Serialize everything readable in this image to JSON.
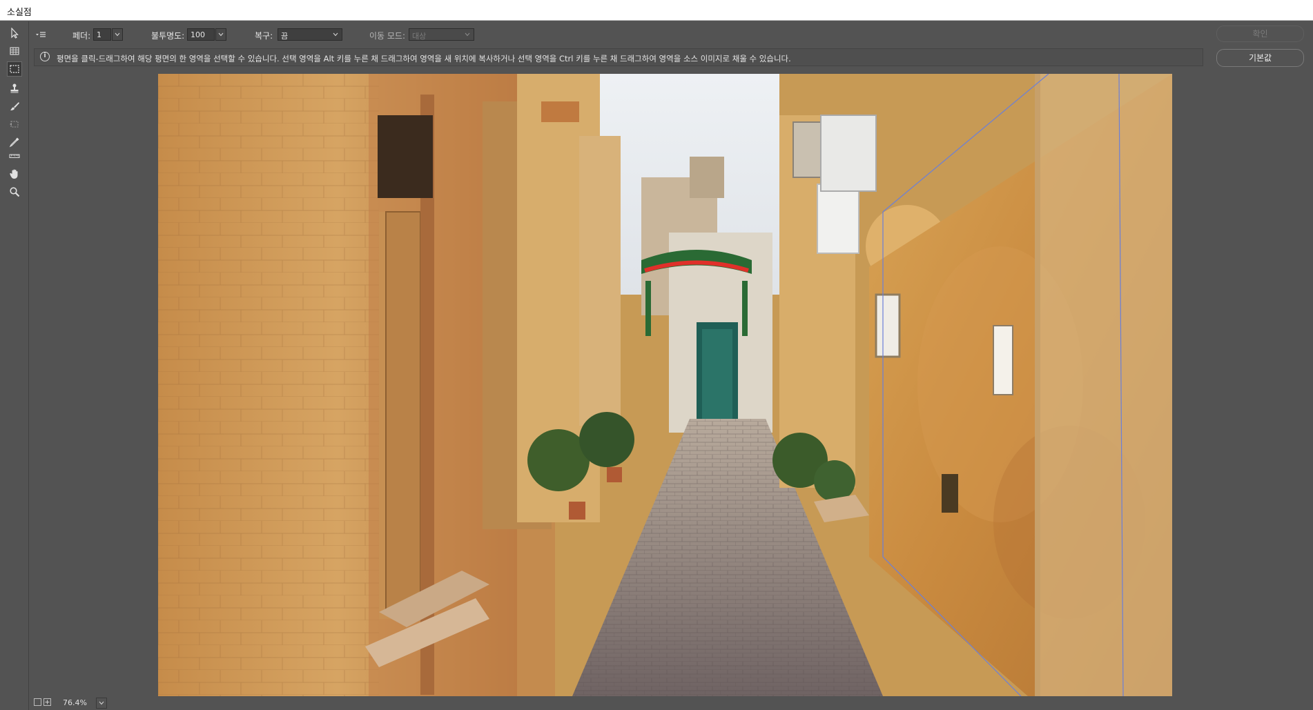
{
  "window": {
    "title": "소실점"
  },
  "options_bar": {
    "menu_icon": "flyout-menu-icon",
    "feather_label": "페더:",
    "feather_value": "1",
    "opacity_label": "불투명도:",
    "opacity_value": "100",
    "heal_label": "복구:",
    "heal_value": "끔",
    "move_mode_label": "이동 모드:",
    "move_mode_value": "대상",
    "ok_label": "확인",
    "default_label": "기본값"
  },
  "info": {
    "icon": "info-icon",
    "text": "평면을 클릭-드래그하여 해당 평면의 한 영역을 선택할 수 있습니다. 선택 영역을 Alt 키를 누른 채 드래그하여 영역을 새 위치에 복사하거나 선택 영역을 Ctrl 키를 누른 채 드래그하여 영역을 소스 이미지로 채울 수 있습니다."
  },
  "tools": [
    {
      "name": "edit-plane-tool",
      "icon": "arrow-icon"
    },
    {
      "name": "create-plane-tool",
      "icon": "grid-plane-icon"
    },
    {
      "name": "marquee-tool",
      "icon": "marquee-icon",
      "active": true
    },
    {
      "name": "stamp-tool",
      "icon": "stamp-icon"
    },
    {
      "name": "brush-tool",
      "icon": "brush-icon"
    },
    {
      "name": "transform-tool",
      "icon": "transform-icon"
    },
    {
      "name": "eyedropper-tool",
      "icon": "eyedropper-icon"
    },
    {
      "name": "measure-tool",
      "icon": "ruler-icon"
    },
    {
      "name": "hand-tool",
      "icon": "hand-icon"
    },
    {
      "name": "zoom-tool",
      "icon": "magnifier-icon"
    }
  ],
  "status": {
    "zoom_value": "76.4%"
  },
  "colors": {
    "panel": "#535353",
    "title_bg": "#ffffff",
    "plane_line": "#6a7fd9"
  }
}
